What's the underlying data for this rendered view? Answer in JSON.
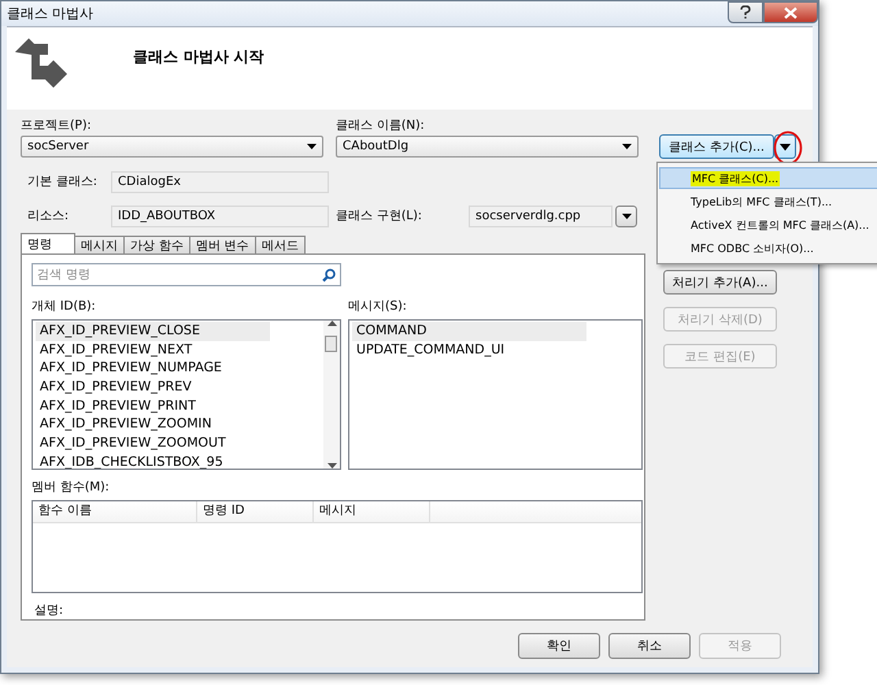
{
  "window": {
    "title": "클래스 마법사"
  },
  "header": {
    "title": "클래스 마법사 시작"
  },
  "project": {
    "label": "프로젝트(P):",
    "value": "socServer"
  },
  "class_name": {
    "label": "클래스 이름(N):",
    "value": "CAboutDlg"
  },
  "add_class_button": {
    "label": "클래스 추가(C)...",
    "circled": true
  },
  "add_class_menu": [
    {
      "label": "MFC 클래스(C)...",
      "selected": true,
      "marked": true
    },
    {
      "label": "TypeLib의 MFC 클래스(T)...",
      "selected": false,
      "marked": false
    },
    {
      "label": "ActiveX 컨트롤의 MFC 클래스(A)...",
      "selected": false,
      "marked": false
    },
    {
      "label": "MFC ODBC 소비자(O)...",
      "selected": false,
      "marked": false
    }
  ],
  "base_class": {
    "label": "기본 클래스:",
    "value": "CDialogEx"
  },
  "resource": {
    "label": "리소스:",
    "value": "IDD_ABOUTBOX"
  },
  "class_impl": {
    "label": "클래스 구현(L):",
    "value": "socserverdlg.cpp"
  },
  "tabs": [
    {
      "label": "명령",
      "selected": true
    },
    {
      "label": "메시지",
      "selected": false
    },
    {
      "label": "가상 함수",
      "selected": false
    },
    {
      "label": "멤버 변수",
      "selected": false
    },
    {
      "label": "메서드",
      "selected": false
    }
  ],
  "search": {
    "placeholder": "검색 명령"
  },
  "object_ids": {
    "label": "개체 ID(B):",
    "items": [
      {
        "text": "AFX_ID_PREVIEW_CLOSE",
        "selected": true
      },
      {
        "text": "AFX_ID_PREVIEW_NEXT",
        "selected": false
      },
      {
        "text": "AFX_ID_PREVIEW_NUMPAGE",
        "selected": false
      },
      {
        "text": "AFX_ID_PREVIEW_PREV",
        "selected": false
      },
      {
        "text": "AFX_ID_PREVIEW_PRINT",
        "selected": false
      },
      {
        "text": "AFX_ID_PREVIEW_ZOOMIN",
        "selected": false
      },
      {
        "text": "AFX_ID_PREVIEW_ZOOMOUT",
        "selected": false
      },
      {
        "text": "AFX_IDB_CHECKLISTBOX_95",
        "selected": false
      }
    ]
  },
  "messages": {
    "label": "메시지(S):",
    "items": [
      {
        "text": "COMMAND",
        "selected": true
      },
      {
        "text": "UPDATE_COMMAND_UI",
        "selected": false
      }
    ]
  },
  "handler_buttons": [
    {
      "label": "처리기 추가(A)...",
      "disabled": false
    },
    {
      "label": "처리기 삭제(D)",
      "disabled": true
    },
    {
      "label": "코드 편집(E)",
      "disabled": true
    }
  ],
  "member_functions": {
    "label": "멤버 함수(M):",
    "columns": [
      "함수 이름",
      "명령 ID",
      "메시지"
    ]
  },
  "description": {
    "label": "설명:"
  },
  "buttons": [
    {
      "label": "확인",
      "disabled": false
    },
    {
      "label": "취소",
      "disabled": false
    },
    {
      "label": "적용",
      "disabled": true
    }
  ]
}
